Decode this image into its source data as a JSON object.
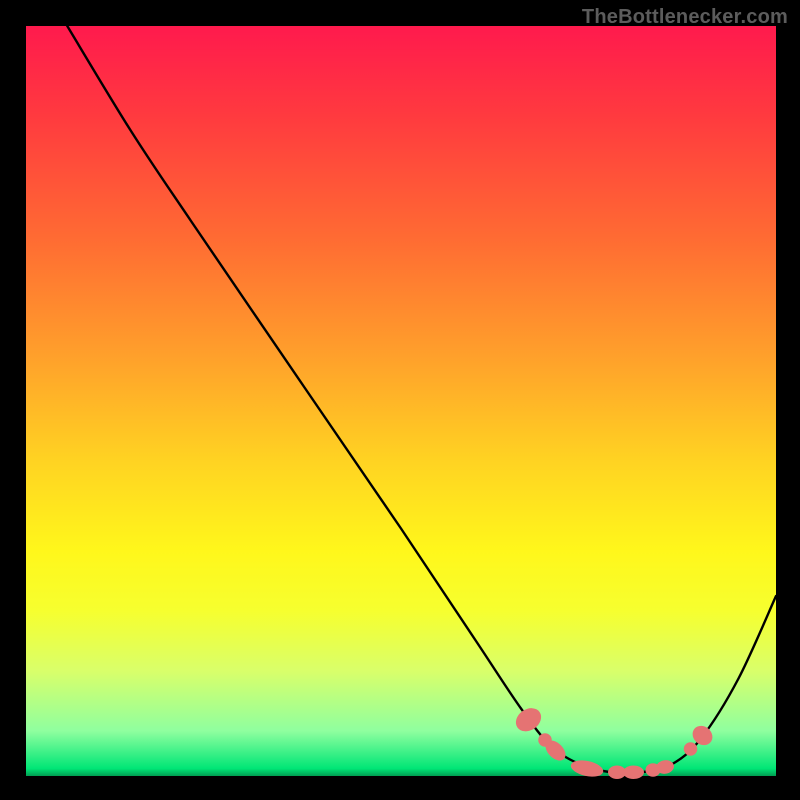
{
  "attribution": "TheBottlenecker.com",
  "chart_data": {
    "type": "line",
    "title": "",
    "xlabel": "",
    "ylabel": "",
    "xlim": [
      0,
      100
    ],
    "ylim": [
      0,
      100
    ],
    "background_gradient": {
      "direction": "vertical",
      "stops": [
        {
          "pos": 0,
          "color": "#ff1a4d"
        },
        {
          "pos": 12,
          "color": "#ff3a3f"
        },
        {
          "pos": 28,
          "color": "#ff6a33"
        },
        {
          "pos": 44,
          "color": "#ffa02b"
        },
        {
          "pos": 58,
          "color": "#ffd322"
        },
        {
          "pos": 70,
          "color": "#fff71b"
        },
        {
          "pos": 78,
          "color": "#f6ff2f"
        },
        {
          "pos": 86,
          "color": "#d9ff6a"
        },
        {
          "pos": 94,
          "color": "#8fff9f"
        },
        {
          "pos": 99,
          "color": "#00e676"
        },
        {
          "pos": 100,
          "color": "#009e52"
        }
      ]
    },
    "series": [
      {
        "name": "bottleneck-curve",
        "color": "#000000",
        "points": [
          {
            "x": 5.5,
            "y": 100.0
          },
          {
            "x": 14.0,
            "y": 86.0
          },
          {
            "x": 22.0,
            "y": 74.0
          },
          {
            "x": 37.0,
            "y": 52.0
          },
          {
            "x": 50.0,
            "y": 33.0
          },
          {
            "x": 60.0,
            "y": 18.0
          },
          {
            "x": 66.0,
            "y": 9.0
          },
          {
            "x": 70.0,
            "y": 4.0
          },
          {
            "x": 74.0,
            "y": 1.5
          },
          {
            "x": 78.0,
            "y": 0.5
          },
          {
            "x": 82.0,
            "y": 0.5
          },
          {
            "x": 86.0,
            "y": 1.5
          },
          {
            "x": 90.0,
            "y": 5.0
          },
          {
            "x": 95.0,
            "y": 13.0
          },
          {
            "x": 100.0,
            "y": 24.0
          }
        ]
      }
    ],
    "markers": [
      {
        "cx": 67.0,
        "cy": 7.5,
        "rx": 1.4,
        "ry": 1.8,
        "rot": 55
      },
      {
        "cx": 69.2,
        "cy": 4.8,
        "rx": 0.9,
        "ry": 0.9,
        "rot": 0
      },
      {
        "cx": 70.6,
        "cy": 3.4,
        "rx": 1.6,
        "ry": 1.0,
        "rot": 45
      },
      {
        "cx": 74.8,
        "cy": 1.0,
        "rx": 2.2,
        "ry": 1.0,
        "rot": 12
      },
      {
        "cx": 78.8,
        "cy": 0.5,
        "rx": 1.2,
        "ry": 0.9,
        "rot": 0
      },
      {
        "cx": 81.0,
        "cy": 0.5,
        "rx": 1.4,
        "ry": 0.9,
        "rot": 0
      },
      {
        "cx": 83.6,
        "cy": 0.8,
        "rx": 1.0,
        "ry": 0.9,
        "rot": 0
      },
      {
        "cx": 85.2,
        "cy": 1.2,
        "rx": 1.2,
        "ry": 0.9,
        "rot": -10
      },
      {
        "cx": 88.6,
        "cy": 3.6,
        "rx": 0.9,
        "ry": 0.9,
        "rot": 0
      },
      {
        "cx": 90.2,
        "cy": 5.4,
        "rx": 1.2,
        "ry": 1.4,
        "rot": -50
      }
    ],
    "marker_color": "#e57373"
  }
}
